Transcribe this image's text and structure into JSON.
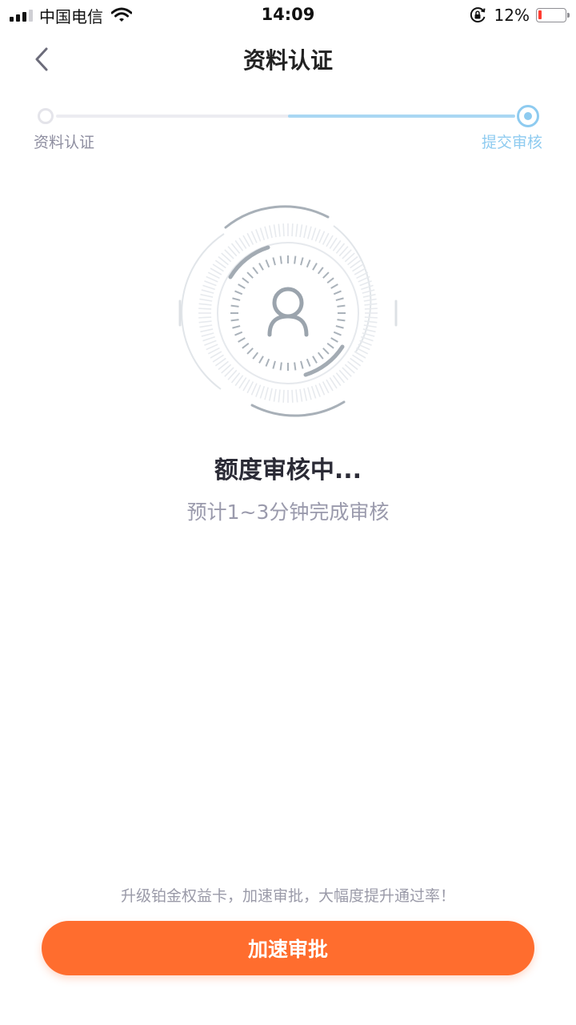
{
  "status_bar": {
    "carrier": "中国电信",
    "time": "14:09",
    "battery_percent": "12%",
    "battery_level": 0.12,
    "battery_color": "#ff3b30",
    "icons": [
      "signal-icon",
      "wifi-icon",
      "rotation-lock-icon",
      "battery-icon"
    ]
  },
  "nav": {
    "title": "资料认证",
    "back_icon": "chevron-left-icon"
  },
  "steps": {
    "items": [
      {
        "label": "资料认证",
        "state": "done"
      },
      {
        "label": "提交审核",
        "state": "current"
      }
    ],
    "active_color": "#8ecbf0"
  },
  "review": {
    "icon": "user-scan-icon",
    "title": "额度审核中...",
    "subtitle": "预计1~3分钟完成审核"
  },
  "footer": {
    "tip": "升级铂金权益卡，加速审批，大幅度提升通过率！",
    "button_label": "加速审批",
    "button_color": "#ff6d2e"
  }
}
